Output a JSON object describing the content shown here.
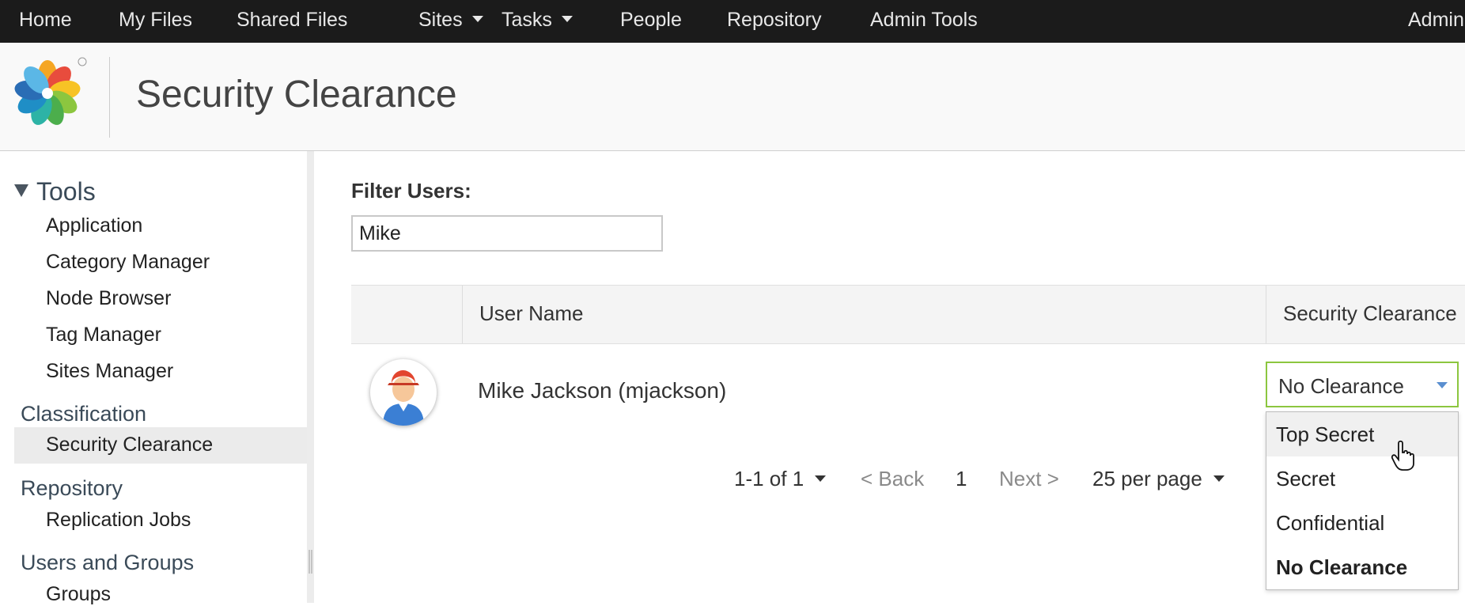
{
  "nav": {
    "items": [
      {
        "label": "Home"
      },
      {
        "label": "My Files"
      },
      {
        "label": "Shared Files"
      },
      {
        "label": "Sites"
      },
      {
        "label": "Tasks"
      },
      {
        "label": "People"
      },
      {
        "label": "Repository"
      },
      {
        "label": "Admin Tools"
      }
    ],
    "user": "Admin"
  },
  "header": {
    "title": "Security Clearance"
  },
  "sidebar": {
    "tools_heading": "Tools",
    "tools_items": [
      "Application",
      "Category Manager",
      "Node Browser",
      "Tag Manager",
      "Sites Manager"
    ],
    "classification_heading": "Classification",
    "classification_items": [
      "Security Clearance"
    ],
    "repository_heading": "Repository",
    "repository_items": [
      "Replication Jobs"
    ],
    "users_heading": "Users and Groups",
    "users_items": [
      "Groups"
    ]
  },
  "filter": {
    "label": "Filter Users:",
    "value": "Mike"
  },
  "table": {
    "columns": [
      "User Name",
      "Security Clearance"
    ],
    "rows": [
      {
        "user_name": "Mike Jackson (mjackson)",
        "clearance": "No Clearance"
      }
    ]
  },
  "dropdown": {
    "options": [
      "Top Secret",
      "Secret",
      "Confidential",
      "No Clearance"
    ],
    "hovered": "Top Secret",
    "selected": "No Clearance"
  },
  "pager": {
    "range": "1-1 of 1",
    "back": "< Back",
    "page": "1",
    "next": "Next >",
    "per_page": "25 per page"
  },
  "colors": {
    "topbar": "#1b1b1b",
    "select_border": "#8cc63f",
    "select_caret": "#5a8fd0"
  }
}
